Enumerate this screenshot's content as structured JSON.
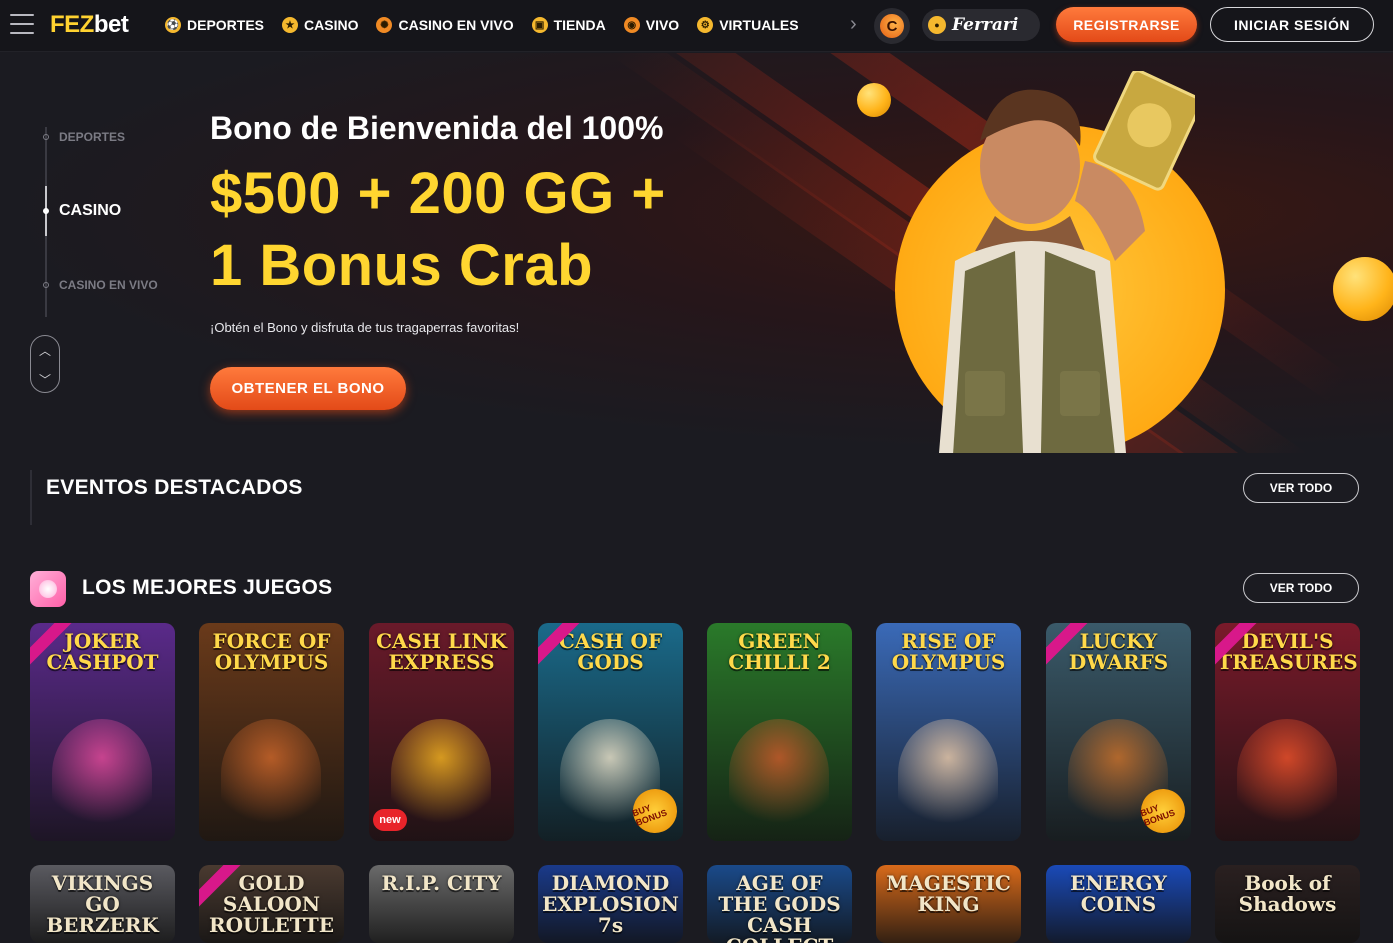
{
  "header": {
    "logo_part1": "FEZ",
    "logo_part2": "bet",
    "nav": [
      {
        "label": "DEPORTES",
        "icon": "soccer-ball-icon"
      },
      {
        "label": "CASINO",
        "icon": "casino-star-icon"
      },
      {
        "label": "CASINO EN VIVO",
        "icon": "roulette-icon"
      },
      {
        "label": "TIENDA",
        "icon": "shop-icon"
      },
      {
        "label": "VIVO",
        "icon": "live-signal-icon"
      },
      {
        "label": "VIRTUALES",
        "icon": "virtual-gear-icon"
      }
    ],
    "promo_brand": "Ferrari",
    "register_label": "REGISTRARSE",
    "login_label": "INICIAR SESIÓN"
  },
  "hero": {
    "side_items": [
      "DEPORTES",
      "CASINO",
      "CASINO EN VIVO"
    ],
    "active_side_item": "CASINO",
    "title": "Bono de Bienvenida del 100%",
    "big_line1": "$500 + 200 GG +",
    "big_line2": "1 Bonus Crab",
    "subtitle": "¡Obtén el Bono y disfruta de tus tragaperras favoritas!",
    "cta_label": "OBTENER EL BONO"
  },
  "events": {
    "title": "EVENTOS DESTACADOS",
    "see_all": "VER TODO"
  },
  "games_section": {
    "title": "LOS MEJORES JUEGOS",
    "see_all": "VER TODO",
    "row1": [
      {
        "title": "JOKER CASHPOT",
        "exclusive": true,
        "bg": "#5a2a8a",
        "art": "#e04a9a"
      },
      {
        "title": "FORCE OF OLYMPUS",
        "exclusive": false,
        "bg": "#6a3a1a",
        "art": "#c9652a"
      },
      {
        "title": "CASH LINK EXPRESS",
        "exclusive": false,
        "bg": "#6a1a2a",
        "art": "#f0b020",
        "new": "new"
      },
      {
        "title": "CASH OF GODS",
        "exclusive": true,
        "bg": "#1a6a8a",
        "art": "#e8e0c8",
        "bonus": "BUY BONUS"
      },
      {
        "title": "GREEN CHILLI 2",
        "exclusive": false,
        "bg": "#2a7a2a",
        "art": "#c85a2a"
      },
      {
        "title": "RISE OF OLYMPUS",
        "exclusive": false,
        "bg": "#3a6ab8",
        "art": "#e8c8a8"
      },
      {
        "title": "LUCKY DWARFS",
        "exclusive": true,
        "bg": "#3a5a6a",
        "art": "#c8702a",
        "bonus": "BUY BONUS"
      },
      {
        "title": "DEVIL'S TREASURES",
        "exclusive": true,
        "bg": "#7a1a2a",
        "art": "#e8502a"
      }
    ],
    "row2": [
      {
        "title": "VIKINGS GO BERZERK",
        "exclusive": false,
        "bg": "#5a5a60"
      },
      {
        "title": "GOLD SALOON ROULETTE",
        "exclusive": true,
        "bg": "#4a3a30"
      },
      {
        "title": "R.I.P. CITY",
        "exclusive": false,
        "bg": "#6a6a6a"
      },
      {
        "title": "DIAMOND EXPLOSION 7s",
        "exclusive": false,
        "bg": "#1a3a8a"
      },
      {
        "title": "AGE OF THE GODS CASH COLLECT",
        "exclusive": false,
        "bg": "#1a4a8a"
      },
      {
        "title": "MAGESTIC KING",
        "exclusive": false,
        "bg": "#d86a1a"
      },
      {
        "title": "ENERGY COINS",
        "exclusive": false,
        "bg": "#1a4ab8"
      },
      {
        "title": "Book of Shadows",
        "exclusive": false,
        "bg": "#2a2020"
      }
    ]
  },
  "colors": {
    "accent_yellow": "#ffd630",
    "cta_orange": "#e34a18",
    "background": "#1b1b21"
  }
}
